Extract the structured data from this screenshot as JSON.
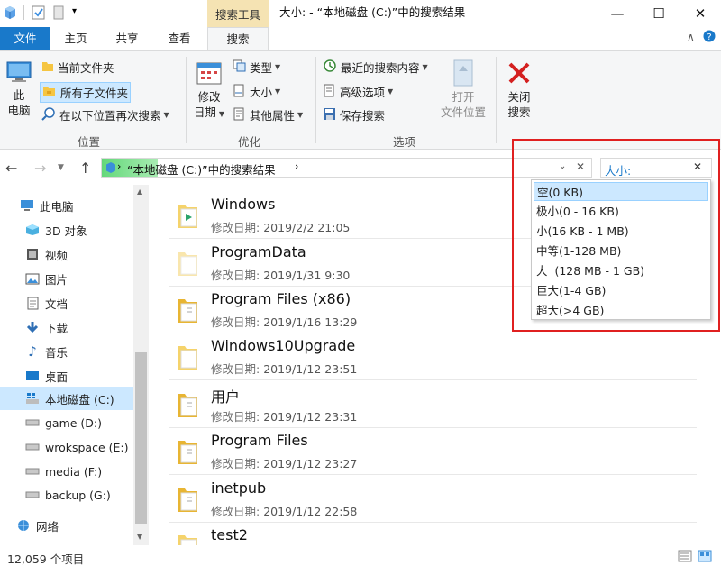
{
  "window": {
    "context_tab": "搜索工具",
    "title": "大小: - “本地磁盘 (C:)”中的搜索结果",
    "minimize": "—",
    "maximize": "☐",
    "close": "✕"
  },
  "tabs": [
    {
      "label": "文件"
    },
    {
      "label": "主页"
    },
    {
      "label": "共享"
    },
    {
      "label": "查看"
    },
    {
      "label": "搜索"
    }
  ],
  "ribbon": {
    "location": {
      "this_pc": "此\n电脑",
      "current_folder": "当前文件夹",
      "all_subfolders": "所有子文件夹",
      "search_again": "在以下位置再次搜索",
      "group": "位置"
    },
    "refine": {
      "modified_date": "修改\n日期",
      "type": "类型",
      "size": "大小",
      "other_props": "其他属性",
      "group": "优化"
    },
    "options": {
      "recent_searches": "最近的搜索内容",
      "advanced": "高级选项",
      "save_search": "保存搜索",
      "open_location": "打开\n文件位置",
      "group": "选项"
    },
    "close": {
      "label": "关闭\n搜索"
    }
  },
  "address": {
    "path": "“本地磁盘 (C:)”中的搜索结果",
    "search_value": "大小:"
  },
  "size_dropdown": [
    "空(0 KB)",
    "极小(0 - 16 KB)",
    "小(16 KB - 1 MB)",
    "中等(1-128 MB)",
    "大  (128 MB - 1 GB)",
    "巨大(1-4 GB)",
    "超大(>4 GB)"
  ],
  "nav_pane": [
    {
      "label": "此电脑",
      "icon": "computer-icon"
    },
    {
      "label": "3D 对象",
      "icon": "3d-objects-icon"
    },
    {
      "label": "视频",
      "icon": "video-icon"
    },
    {
      "label": "图片",
      "icon": "pictures-icon"
    },
    {
      "label": "文档",
      "icon": "documents-icon"
    },
    {
      "label": "下载",
      "icon": "download-icon"
    },
    {
      "label": "音乐",
      "icon": "music-icon"
    },
    {
      "label": "桌面",
      "icon": "desktop-icon"
    },
    {
      "label": "本地磁盘 (C:)",
      "icon": "windows-drive-icon"
    },
    {
      "label": "game (D:)",
      "icon": "drive-icon"
    },
    {
      "label": "wrokspace (E:)",
      "icon": "drive-icon"
    },
    {
      "label": "media (F:)",
      "icon": "drive-icon"
    },
    {
      "label": "backup (G:)",
      "icon": "drive-icon"
    },
    {
      "label": "网络",
      "icon": "network-icon"
    }
  ],
  "results": {
    "date_label": "修改日期:",
    "items": [
      {
        "name": "Windows",
        "date": "2019/2/2 21:05"
      },
      {
        "name": "ProgramData",
        "date": "2019/1/31 9:30"
      },
      {
        "name": "Program Files (x86)",
        "date": "2019/1/16 13:29"
      },
      {
        "name": "Windows10Upgrade",
        "date": "2019/1/12 23:51"
      },
      {
        "name": "用户",
        "date": "2019/1/12 23:31"
      },
      {
        "name": "Program Files",
        "date": "2019/1/12 23:27"
      },
      {
        "name": "inetpub",
        "date": "2019/1/12 22:58"
      },
      {
        "name": "test2",
        "date": ""
      }
    ]
  },
  "status": {
    "count": "12,059 个项目"
  },
  "colors": {
    "accent": "#1979ca",
    "selection": "#cce8ff",
    "highlight_box": "#e02020",
    "context_tab": "#f5e3b3"
  }
}
